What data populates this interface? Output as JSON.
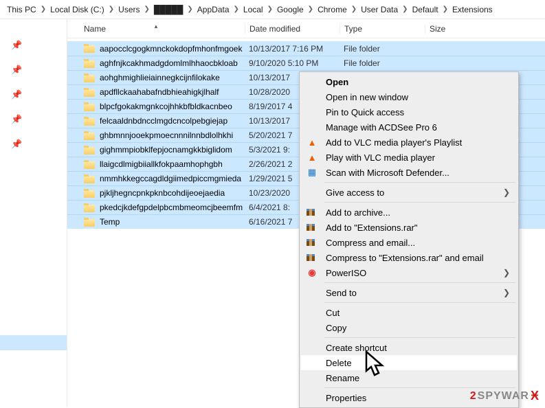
{
  "breadcrumb": [
    "This PC",
    "Local Disk (C:)",
    "Users",
    "█████",
    "AppData",
    "Local",
    "Google",
    "Chrome",
    "User Data",
    "Default",
    "Extensions"
  ],
  "columns": {
    "name": "Name",
    "date": "Date modified",
    "type": "Type",
    "size": "Size"
  },
  "files": [
    {
      "name": "aapocclcgogkmnckokdopfmhonfmgoek",
      "date": "10/13/2017 7:16 PM",
      "type": "File folder"
    },
    {
      "name": "aghfnjkcakhmadgdomlmlhhaocbkloab",
      "date": "9/10/2020 5:10 PM",
      "type": "File folder"
    },
    {
      "name": "aohghmighlieiainnegkcijnfilokake",
      "date": "10/13/2017",
      "type": ""
    },
    {
      "name": "apdfllckaahabafndbhieahigkjlhalf",
      "date": "10/28/2020",
      "type": ""
    },
    {
      "name": "blpcfgokakmgnkcojhhkbfbldkacnbeo",
      "date": "8/19/2017 4",
      "type": ""
    },
    {
      "name": "felcaaldnbdncclmgdcncolpebgiejap",
      "date": "10/13/2017",
      "type": ""
    },
    {
      "name": "ghbmnnjooekpmoecnnnilnnbdlolhkhi",
      "date": "5/20/2021 7",
      "type": ""
    },
    {
      "name": "gighmmpiobklfepjocnamgkkbiglidom",
      "date": "5/3/2021 9:",
      "type": ""
    },
    {
      "name": "llaigcdlmigbiiallkfokpaamhophgbh",
      "date": "2/26/2021 2",
      "type": ""
    },
    {
      "name": "nmmhkkegccagdldgiimedpiccmgmieda",
      "date": "1/29/2021 5",
      "type": ""
    },
    {
      "name": "pjkljhegncpnkpknbcohdijeoejaedia",
      "date": "10/23/2020",
      "type": ""
    },
    {
      "name": "pkedcjkdefgpdelpbcmbmeomcjbeemfm",
      "date": "6/4/2021 8:",
      "type": ""
    },
    {
      "name": "Temp",
      "date": "6/16/2021 7",
      "type": ""
    }
  ],
  "menu": {
    "open": "Open",
    "open_new": "Open in new window",
    "pin": "Pin to Quick access",
    "acdsee": "Manage with ACDSee Pro 6",
    "vlc_add": "Add to VLC media player's Playlist",
    "vlc_play": "Play with VLC media player",
    "defender": "Scan with Microsoft Defender...",
    "access": "Give access to",
    "rar_add": "Add to archive...",
    "rar_ext": "Add to \"Extensions.rar\"",
    "rar_email": "Compress and email...",
    "rar_ext_email": "Compress to \"Extensions.rar\" and email",
    "poweriso": "PowerISO",
    "sendto": "Send to",
    "cut": "Cut",
    "copy": "Copy",
    "shortcut": "Create shortcut",
    "delete": "Delete",
    "rename": "Rename",
    "properties": "Properties"
  },
  "watermark": {
    "two": "2",
    "text": "SPYWAR"
  }
}
